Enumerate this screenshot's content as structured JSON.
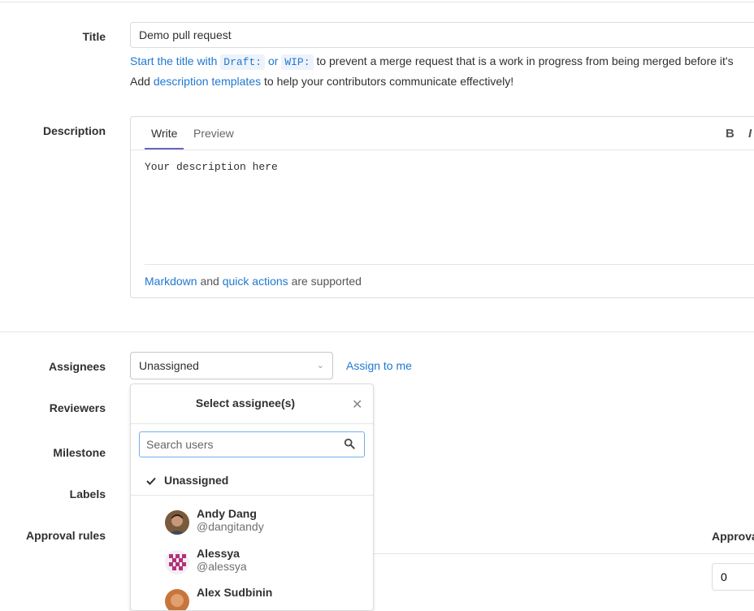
{
  "title_field": {
    "label": "Title",
    "value": "Demo pull request",
    "help_prefix": "Start the title with",
    "draft_tag": "Draft:",
    "or": "or",
    "wip_tag": "WIP:",
    "help_suffix": "to prevent a merge request that is a work in progress from being merged before it's",
    "templates_prefix": "Add",
    "templates_link": "description templates",
    "templates_suffix": "to help your contributors communicate effectively!"
  },
  "description": {
    "label": "Description",
    "tab_write": "Write",
    "tab_preview": "Preview",
    "toolbar_bold": "B",
    "toolbar_italic": "I",
    "text": "Your description here",
    "markdown_link": "Markdown",
    "and": "and",
    "quick_actions_link": "quick actions",
    "supported": "are supported"
  },
  "sidebar_labels": {
    "assignees": "Assignees",
    "reviewers": "Reviewers",
    "milestone": "Milestone",
    "labels": "Labels",
    "approval_rules": "Approval rules"
  },
  "assignee": {
    "selected": "Unassigned",
    "assign_to_me": "Assign to me",
    "dropdown_title": "Select assignee(s)",
    "search_placeholder": "Search users",
    "unassigned_option": "Unassigned",
    "users": [
      {
        "name": "Andy Dang",
        "handle": "@dangitandy"
      },
      {
        "name": "Alessya",
        "handle": "@alessya"
      },
      {
        "name": "Alex Sudbinin",
        "handle": ""
      }
    ]
  },
  "approvals": {
    "header": "Approvals",
    "value": "0"
  },
  "colors": {
    "link": "#1f78d1",
    "tab_underline": "#6666c4",
    "search_focus_border": "#73afea"
  },
  "icons": [
    "chevron-down-icon",
    "close-icon",
    "search-icon",
    "check-icon",
    "bold-icon",
    "italic-icon"
  ]
}
